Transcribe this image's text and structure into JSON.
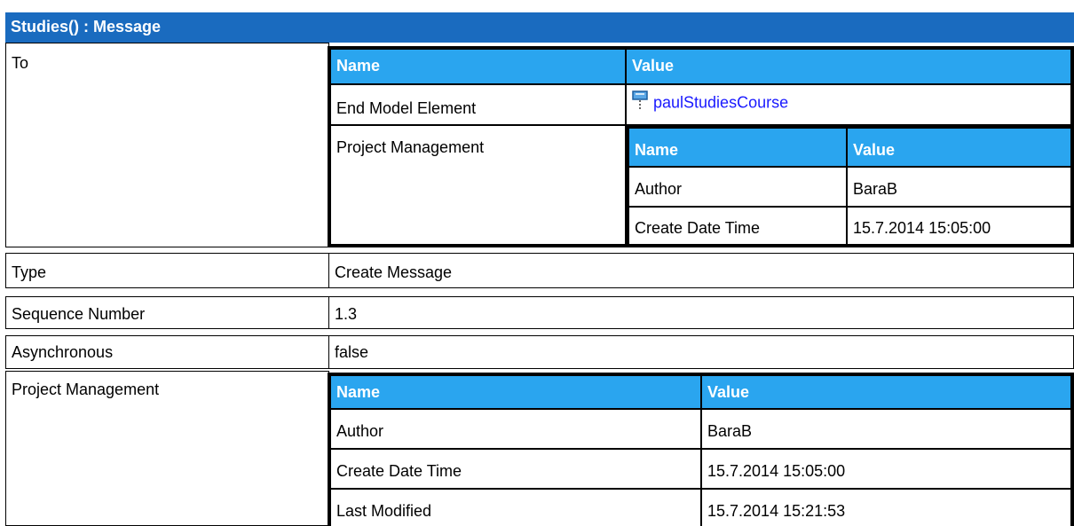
{
  "title": "Studies() : Message",
  "to": {
    "label": "To",
    "table": {
      "headers": [
        "Name",
        "Value"
      ],
      "end_model_element": {
        "label": "End Model Element",
        "value": "paulStudiesCourse",
        "icon": "lifeline-icon"
      },
      "project_management": {
        "label": "Project Management",
        "headers": [
          "Name",
          "Value"
        ],
        "rows": [
          [
            "Author",
            "BaraB"
          ],
          [
            "Create Date Time",
            "15.7.2014 15:05:00"
          ]
        ]
      }
    }
  },
  "properties": [
    {
      "label": "Type",
      "value": "Create Message"
    },
    {
      "label": "Sequence Number",
      "value": "1.3"
    },
    {
      "label": "Asynchronous",
      "value": "false"
    }
  ],
  "project_management": {
    "label": "Project Management",
    "headers": [
      "Name",
      "Value"
    ],
    "rows": [
      [
        "Author",
        "BaraB"
      ],
      [
        "Create Date Time",
        "15.7.2014 15:05:00"
      ],
      [
        "Last Modified",
        "15.7.2014 15:21:53"
      ]
    ]
  },
  "colors": {
    "title_bar": "#1a6bbf",
    "table_header": "#2aa5ef",
    "link": "#1a1aff"
  }
}
